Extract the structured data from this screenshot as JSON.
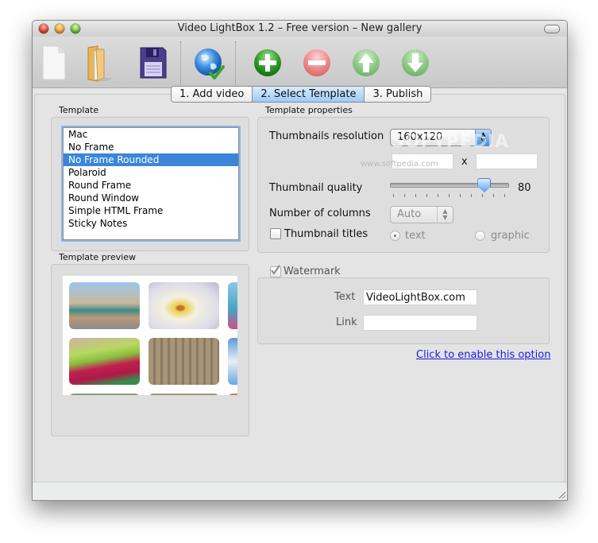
{
  "window": {
    "title": "Video LightBox 1.2 – Free version – New gallery"
  },
  "toolbar": {
    "buttons": [
      {
        "name": "new-gallery-button",
        "icon": "new-document-icon",
        "enabled": true
      },
      {
        "name": "open-gallery-button",
        "icon": "folder-open-icon",
        "enabled": true
      },
      {
        "name": "save-gallery-button",
        "icon": "floppy-disk-icon",
        "enabled": true
      },
      {
        "name": "publish-web-button",
        "icon": "globe-check-icon",
        "enabled": true
      },
      {
        "name": "add-video-button",
        "icon": "plus-circle-icon",
        "enabled": true
      },
      {
        "name": "remove-video-button",
        "icon": "minus-circle-icon",
        "enabled": false
      },
      {
        "name": "move-up-button",
        "icon": "arrow-up-circle-icon",
        "enabled": false
      },
      {
        "name": "move-down-button",
        "icon": "arrow-down-circle-icon",
        "enabled": false
      }
    ]
  },
  "tabs": [
    {
      "label": "1. Add video",
      "active": false
    },
    {
      "label": "2. Select Template",
      "active": true
    },
    {
      "label": "3. Publish",
      "active": false
    }
  ],
  "template": {
    "label": "Template",
    "items": [
      "Mac",
      "No Frame",
      "No Frame Rounded",
      "Polaroid",
      "Round Frame",
      "Round Window",
      "Simple HTML Frame",
      "Sticky Notes"
    ],
    "selected": "No Frame Rounded"
  },
  "preview": {
    "label": "Template preview",
    "thumbnails": [
      "city-skyline",
      "calla-lily",
      "blue-tower",
      "flower-bed",
      "cathedral",
      "sky-clouds",
      "garden",
      "stone-wall",
      "red-flowers"
    ]
  },
  "properties": {
    "label": "Template properties",
    "resolution_label": "Thumbnails resolution",
    "resolution_value": "160x120",
    "width_value": "",
    "height_value": "",
    "times_sign": "x",
    "quality_label": "Thumbnail quality",
    "quality_value": "80",
    "quality_percent": 80,
    "columns_label": "Number of columns",
    "columns_value": "Auto",
    "titles_label": "Thumbnail titles",
    "titles_checked": false,
    "titles_text_option": "text",
    "titles_graphic_option": "graphic",
    "titles_selected": "text"
  },
  "watermark": {
    "label": "Watermark",
    "checked": true,
    "text_label": "Text",
    "text_value": "VideoLightBox.com",
    "link_label": "Link",
    "link_value": "",
    "enable_link": "Click to enable this option"
  },
  "overlay": {
    "logo": "SOFTPEDIA",
    "url": "www.softpedia.com"
  }
}
